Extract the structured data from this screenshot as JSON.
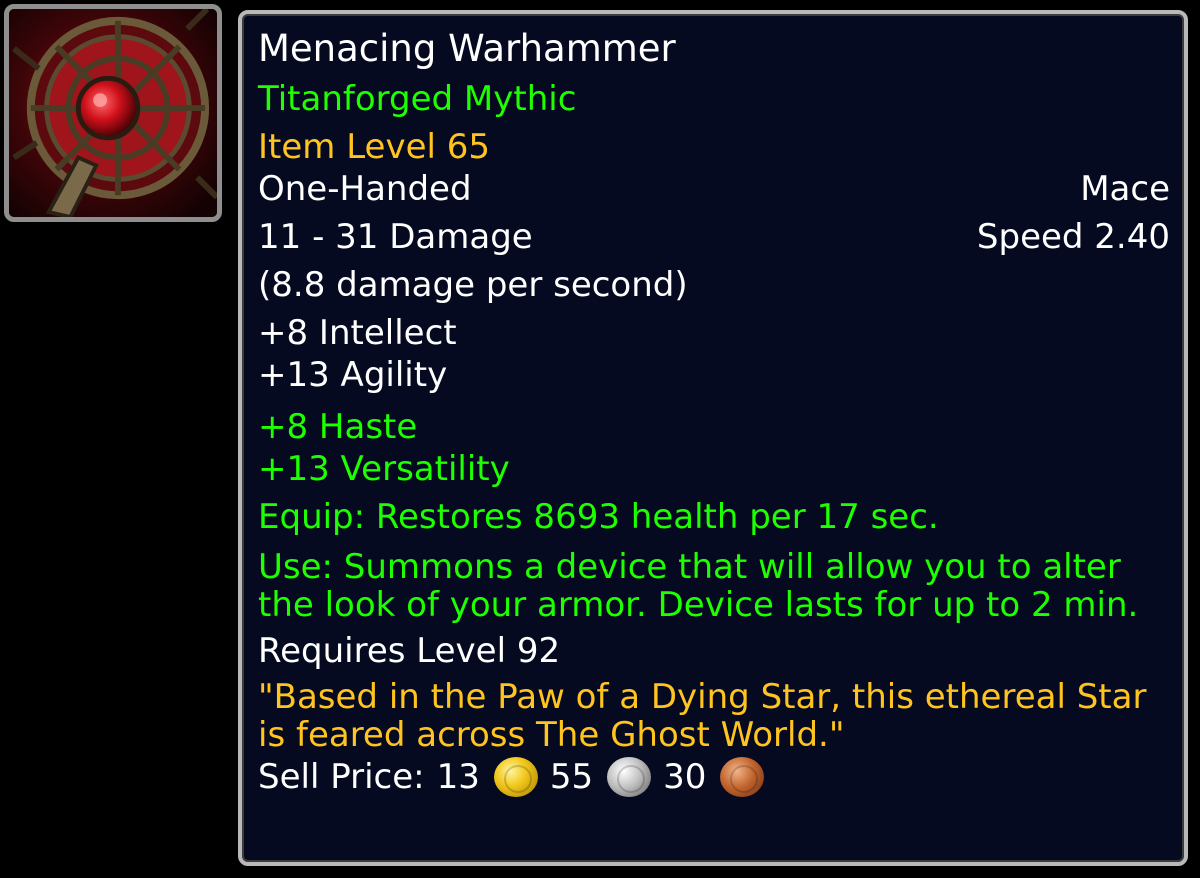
{
  "icon": {
    "name": "warhammer-icon"
  },
  "item": {
    "name": "Menacing Warhammer",
    "quality": "Titanforged Mythic",
    "item_level": "Item Level 65",
    "slot": "One-Handed",
    "type": "Mace",
    "damage": "11 - 31 Damage",
    "speed": "Speed 2.40",
    "dps": "(8.8 damage per second)",
    "stats_primary": [
      "+8 Intellect",
      "+13 Agility"
    ],
    "stats_secondary": [
      "+8 Haste",
      "+13 Versatility"
    ],
    "equip": "Equip: Restores 8693 health per 17 sec.",
    "use": "Use: Summons a device that will allow you to alter the look of your armor. Device lasts for up to 2 min.",
    "requires": "Requires Level 92",
    "flavor": "\"Based in the Paw of a Dying Star, this ethereal Star is feared across The Ghost World.\"",
    "sell_label": "Sell Price:",
    "sell_gold": "13",
    "sell_silver": "55",
    "sell_copper": "30"
  },
  "colors": {
    "background": "#000000",
    "tooltip_bg": "#050a20",
    "border": "#b9b9b9",
    "white_text": "#ffffff",
    "green_text": "#1eff00",
    "gold_text": "#ffc41f"
  }
}
